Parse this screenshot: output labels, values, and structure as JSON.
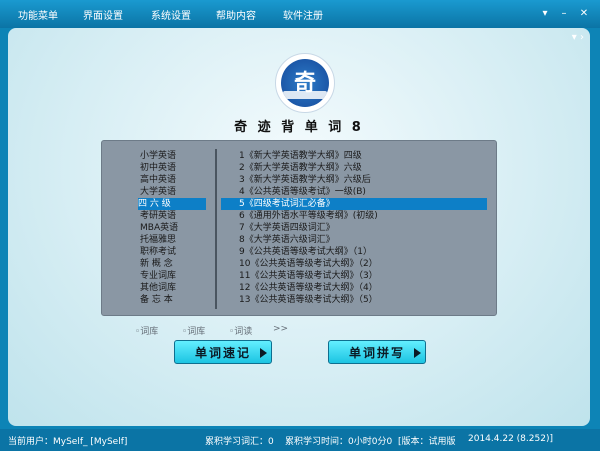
{
  "menu": {
    "items": [
      "功能菜单",
      "界面设置",
      "系统设置",
      "帮助内容",
      "软件注册"
    ]
  },
  "window_controls": {
    "dropdown": "▾",
    "minimize": "–",
    "close": "✕"
  },
  "app": {
    "title": "奇 迹 背 单 词 8",
    "logo_char": "奇"
  },
  "categories": [
    {
      "label": "小学英语",
      "selected": false
    },
    {
      "label": "初中英语",
      "selected": false
    },
    {
      "label": "高中英语",
      "selected": false
    },
    {
      "label": "大学英语",
      "selected": false
    },
    {
      "label": "四 六 级",
      "selected": true
    },
    {
      "label": "考研英语",
      "selected": false
    },
    {
      "label": "MBA英语",
      "selected": false
    },
    {
      "label": "托福雅思",
      "selected": false
    },
    {
      "label": "职称考试",
      "selected": false
    },
    {
      "label": "新 概 念",
      "selected": false
    },
    {
      "label": "专业词库",
      "selected": false
    },
    {
      "label": "其他词库",
      "selected": false
    },
    {
      "label": "备 忘 本",
      "selected": false
    }
  ],
  "books": [
    {
      "label": "1《新大学英语教学大纲》四级",
      "selected": false
    },
    {
      "label": "2《新大学英语教学大纲》六级",
      "selected": false
    },
    {
      "label": "3《新大学英语教学大纲》六级后",
      "selected": false
    },
    {
      "label": "4《公共英语等级考试》一级(B)",
      "selected": false
    },
    {
      "label": "5《四级考试词汇必备》",
      "selected": true
    },
    {
      "label": "6《通用外语水平等级考纲》(初级)",
      "selected": false
    },
    {
      "label": "7《大学英语四级词汇》",
      "selected": false
    },
    {
      "label": "8《大学英语六级词汇》",
      "selected": false
    },
    {
      "label": "9《公共英语等级考试大纲》（1）",
      "selected": false
    },
    {
      "label": "10《公共英语等级考试大纲》（2）",
      "selected": false
    },
    {
      "label": "11《公共英语等级考试大纲》（3）",
      "selected": false
    },
    {
      "label": "12《公共英语等级考试大纲》（4）",
      "selected": false
    },
    {
      "label": "13《公共英语等级考试大纲》（5）",
      "selected": false
    }
  ],
  "tabs": [
    "◦词库",
    "◦词库",
    "◦词读",
    ">>"
  ],
  "buttons": {
    "quick_memorize": "单词速记",
    "spelling": "单词拼写"
  },
  "status": {
    "user": "当前用户：MySelf_ [MySelf]",
    "words_learned": "累积学习词汇：0",
    "study_time": "累积学习时间：0小时0分0",
    "version": "[版本：试用版",
    "date_build": "2014.4.22  (8.252)]"
  }
}
